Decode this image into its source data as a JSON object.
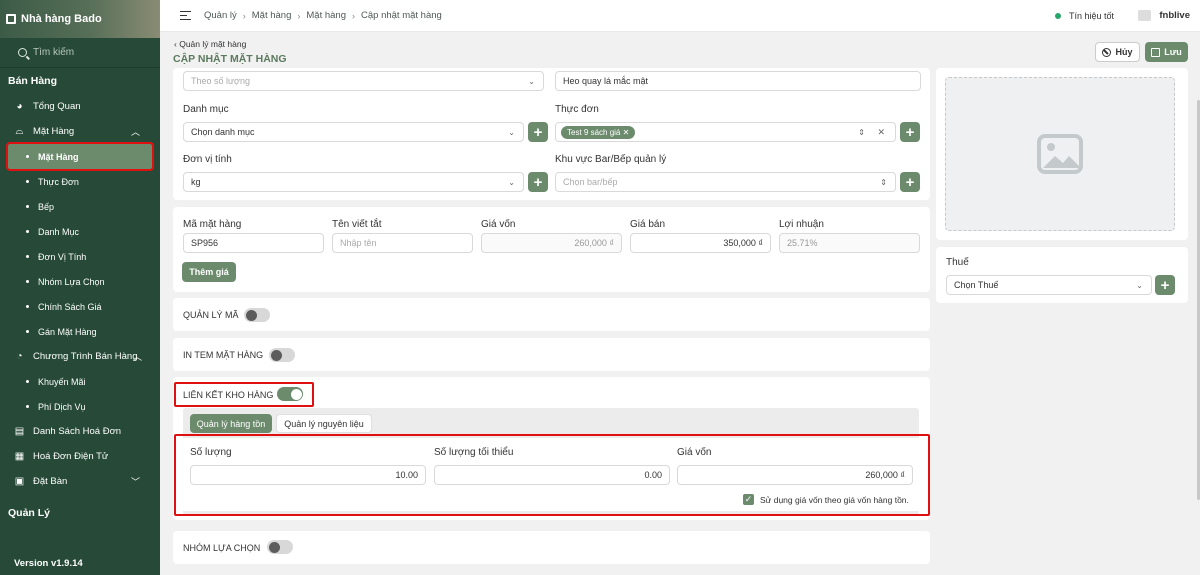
{
  "sidebar": {
    "brand": "Nhà hàng Bado",
    "search_placeholder": "Tìm kiếm",
    "section_sales": "Bán Hàng",
    "section_manage": "Quản Lý",
    "items": {
      "overview": "Tổng Quan",
      "products": "Mặt Hàng",
      "sales_programs": "Chương Trình Bán Hàng",
      "invoice_list": "Danh Sách Hoá Đơn",
      "e_invoice": "Hoá Đơn Điện Tử",
      "booking": "Đặt Bàn"
    },
    "product_sub": [
      "Mặt Hàng",
      "Thực Đơn",
      "Bếp",
      "Danh Mục",
      "Đơn Vị Tính",
      "Nhóm Lựa Chọn",
      "Chính Sách Giá",
      "Gán Mặt Hàng"
    ],
    "program_sub": [
      "Khuyến Mãi",
      "Phí Dịch Vụ"
    ],
    "version": "Version v1.9.14",
    "colors": {
      "bg": "#264a37",
      "active": "#6b8b6c",
      "highlight": "#e01010"
    }
  },
  "topbar": {
    "breadcrumb": [
      "Quản lý",
      "Mặt hàng",
      "Mặt hàng",
      "Cập nhật mặt hàng"
    ],
    "signal": "Tín hiệu tốt",
    "user": "fnblive"
  },
  "header": {
    "back": "Quản lý mặt hàng",
    "title": "CẬP NHẬT MẶT HÀNG",
    "cancel": "Hủy",
    "save": "Lưu"
  },
  "form": {
    "track_by_placeholder": "Theo số lượng",
    "name_value": "Heo quay lá mắc mật",
    "category_label": "Danh mục",
    "category_placeholder": "Chọn danh mục",
    "menu_label": "Thực đơn",
    "menu_tag": "Test 9 sách giá",
    "unit_label": "Đơn vị tính",
    "unit_value": "kg",
    "bar_label": "Khu vực Bar/Bếp quản lý",
    "bar_placeholder": "Chọn bar/bếp",
    "code_label": "Mã mặt hàng",
    "code_value": "SP956",
    "short_label": "Tên viết tắt",
    "short_placeholder": "Nhập tên",
    "cost_label": "Giá vốn",
    "cost_value": "260,000 ₫",
    "price_label": "Giá bán",
    "price_value": "350,000 ₫",
    "profit_label": "Lợi nhuận",
    "profit_value": "25.71%",
    "add_price": "Thêm giá",
    "manage_code": "QUẢN LÝ MÃ",
    "print_label": "IN TEM MẶT HÀNG",
    "link_warehouse": "LIÊN KẾT KHO HÀNG",
    "tab_inventory": "Quản lý hàng tồn",
    "tab_material": "Quản lý nguyên liệu",
    "qty_label": "Số lượng",
    "qty_value": "10.00",
    "min_qty_label": "Số lượng tối thiểu",
    "min_qty_value": "0.00",
    "inv_cost_label": "Giá vốn",
    "inv_cost_value": "260,000 ₫",
    "use_cost_check": "Sử dụng giá vốn theo giá vốn hàng tồn.",
    "option_group": "NHÓM LỰA CHỌN",
    "toggles": {
      "manage_code": false,
      "print_label": false,
      "link_warehouse": true,
      "option_group": false
    }
  },
  "right_panel": {
    "tax_label": "Thuế",
    "tax_placeholder": "Chọn Thuế"
  }
}
